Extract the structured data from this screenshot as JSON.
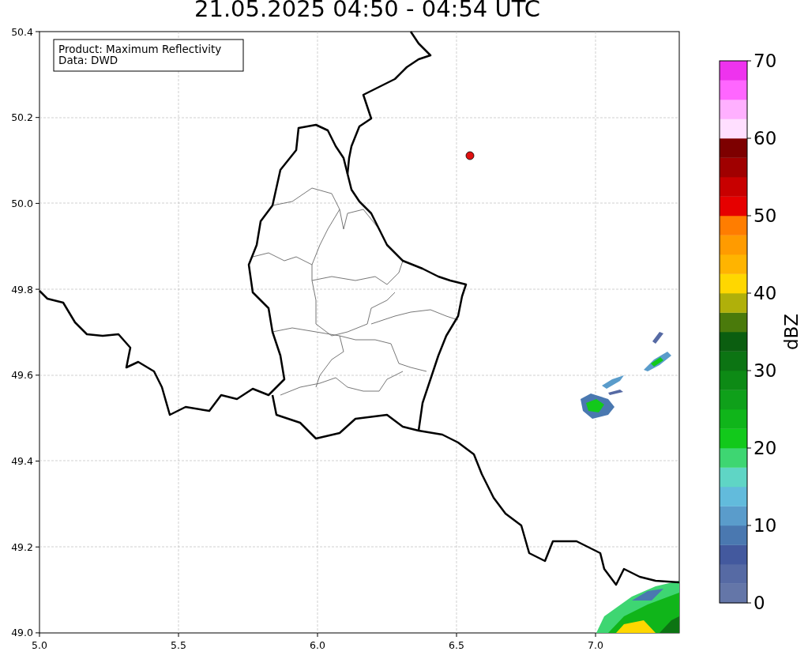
{
  "title": "21.05.2025 04:50 - 04:54 UTC",
  "info_box": [
    "Product: Maximum Reflectivity",
    "Data: DWD"
  ],
  "map": {
    "xticks": [
      "5.0",
      "5.5",
      "6.0",
      "6.5",
      "7.0"
    ],
    "yticks": [
      "50.4",
      "50.2",
      "50.0",
      "49.8",
      "49.6",
      "49.4",
      "49.2",
      "49.0"
    ]
  },
  "colorbar": {
    "label": "dBZ",
    "ticks": [
      "70",
      "60",
      "50",
      "40",
      "30",
      "20",
      "10",
      "0"
    ],
    "segments": [
      {
        "color": "#6476a8"
      },
      {
        "color": "#566aa4"
      },
      {
        "color": "#43599e"
      },
      {
        "color": "#4a78b0"
      },
      {
        "color": "#5a9ccb"
      },
      {
        "color": "#62bbdc"
      },
      {
        "color": "#5fd5c5"
      },
      {
        "color": "#3ed672"
      },
      {
        "color": "#12c91b"
      },
      {
        "color": "#10b51a"
      },
      {
        "color": "#0fa01a"
      },
      {
        "color": "#0d8a15"
      },
      {
        "color": "#0c7413"
      },
      {
        "color": "#0b5e10"
      },
      {
        "color": "#4a7a0b"
      },
      {
        "color": "#b0b00a"
      },
      {
        "color": "#ffd700"
      },
      {
        "color": "#ffb400"
      },
      {
        "color": "#ff9b00"
      },
      {
        "color": "#ff7d00"
      },
      {
        "color": "#e60000"
      },
      {
        "color": "#c80000"
      },
      {
        "color": "#a00000"
      },
      {
        "color": "#7d0000"
      },
      {
        "color": "#ffdfff"
      },
      {
        "color": "#ffb0ff"
      },
      {
        "color": "#ff66ff"
      },
      {
        "color": "#ee33ee"
      }
    ]
  }
}
